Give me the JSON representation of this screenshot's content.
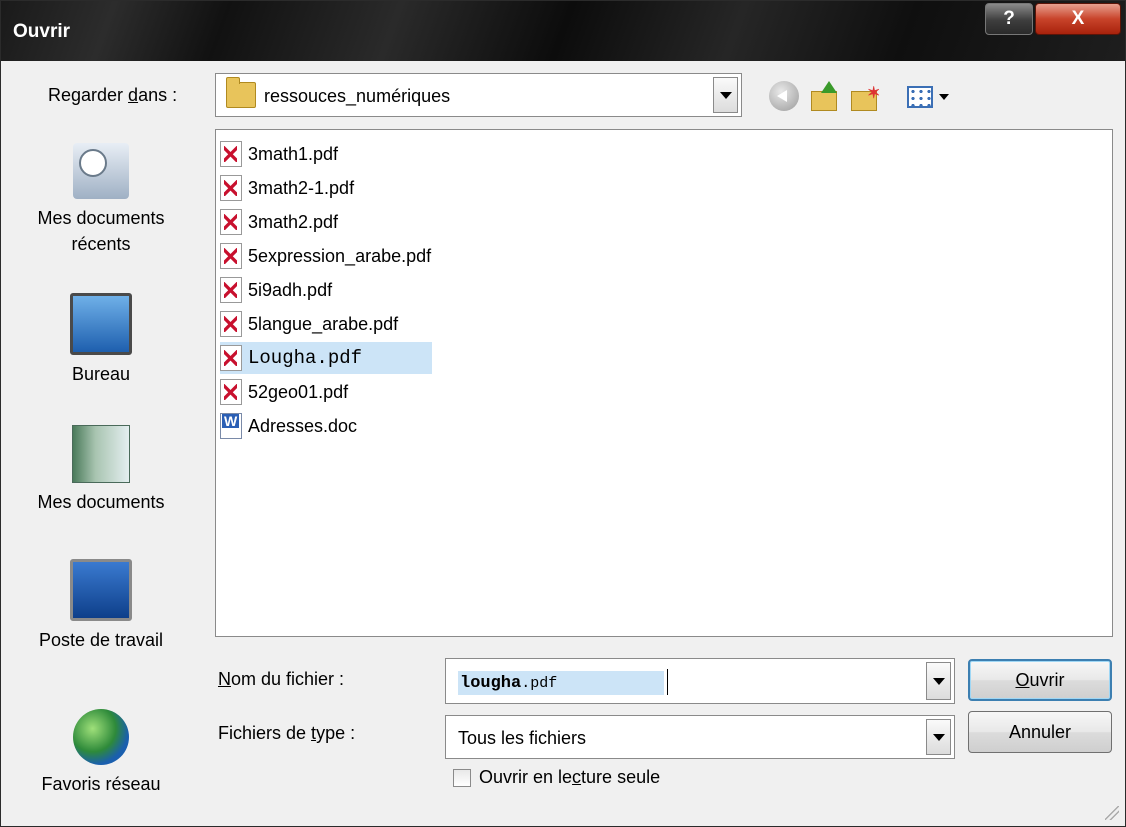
{
  "window": {
    "title": "Ouvrir",
    "help_label": "?",
    "close_label": "X"
  },
  "lookin": {
    "label_pre": "Regarder ",
    "label_ul": "d",
    "label_post": "ans :",
    "value": "ressouces_numériques"
  },
  "toolbar": {
    "back": "back-arrow-icon",
    "up": "up-folder-icon",
    "new_folder": "new-folder-icon",
    "views": "views-menu-icon"
  },
  "places": [
    {
      "line1": "Mes documents",
      "line2": "récents",
      "icon": "recent-documents-icon"
    },
    {
      "line1": "Bureau",
      "icon": "desktop-icon"
    },
    {
      "line1": "Mes documents",
      "icon": "my-documents-icon"
    },
    {
      "line1": "Poste de travail",
      "icon": "my-computer-icon"
    },
    {
      "line1": "Favoris réseau",
      "icon": "network-places-icon"
    }
  ],
  "files": [
    {
      "name": "3math1.pdf",
      "type": "pdf"
    },
    {
      "name": "3math2-1.pdf",
      "type": "pdf"
    },
    {
      "name": "3math2.pdf",
      "type": "pdf"
    },
    {
      "name": "5expression_arabe.pdf",
      "type": "pdf"
    },
    {
      "name": "5i9adh.pdf",
      "type": "pdf"
    },
    {
      "name": "5langue_arabe.pdf",
      "type": "pdf"
    },
    {
      "name": "Lougha.pdf",
      "type": "pdf",
      "selected": true
    },
    {
      "name": "52geo01.pdf",
      "type": "pdf"
    },
    {
      "name": "Adresses.doc",
      "type": "doc"
    }
  ],
  "filename": {
    "label_ul": "N",
    "label_post": "om du fichier :",
    "value_main": "lougha",
    "value_ext": ".pdf"
  },
  "filetype": {
    "label_pre": "Fichiers de ",
    "label_ul": "t",
    "label_post": "ype :",
    "value": "Tous les fichiers"
  },
  "readonly": {
    "label_pre": "Ouvrir en le",
    "label_ul": "c",
    "label_post": "ture seule",
    "checked": false
  },
  "buttons": {
    "ok_ul": "O",
    "ok_post": "uvrir",
    "cancel": "Annuler"
  }
}
